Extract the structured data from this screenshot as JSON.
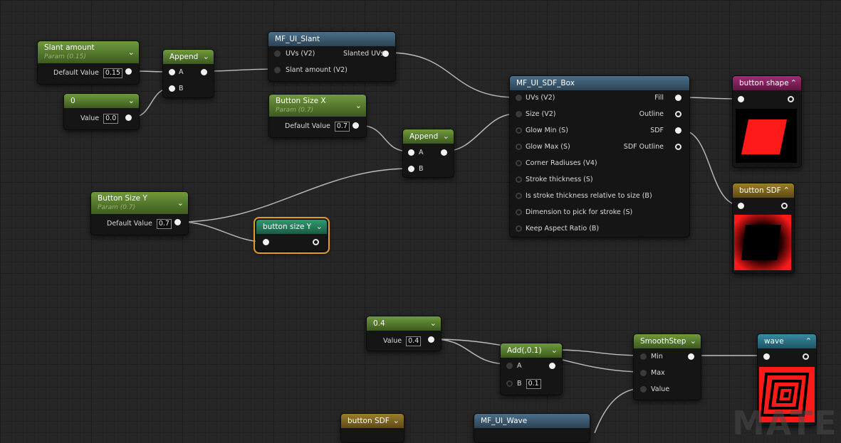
{
  "nodes": {
    "slant_amount": {
      "title": "Slant amount",
      "subtitle": "Param (0.15)",
      "label": "Default Value",
      "value": "0.15"
    },
    "const_zero": {
      "title": "0",
      "label": "Value",
      "value": "0.0"
    },
    "append_1": {
      "title": "Append",
      "pin_a": "A",
      "pin_b": "B"
    },
    "mf_ui_slant": {
      "title": "MF_UI_Slant",
      "in_uvs": "UVs (V2)",
      "in_slant": "Slant amount (V2)",
      "out": "Slanted UVs"
    },
    "button_size_x": {
      "title": "Button Size X",
      "subtitle": "Param (0.7)",
      "label": "Default Value",
      "value": "0.7"
    },
    "append_2": {
      "title": "Append",
      "pin_a": "A",
      "pin_b": "B"
    },
    "mf_ui_sdf_box": {
      "title": "MF_UI_SDF_Box",
      "inputs": [
        "UVs (V2)",
        "Size (V2)",
        "Glow Min (S)",
        "Glow Max (S)",
        "Corner Radiuses (V4)",
        "Stroke thickness (S)",
        "Is stroke thickness relative to size (B)",
        "Dimension to pick for stroke (S)",
        "Keep Aspect Ratio (B)"
      ],
      "outputs": [
        "Fill",
        "Outline",
        "SDF",
        "SDF Outline"
      ]
    },
    "button_shape": {
      "title": "button shape"
    },
    "button_sdf_preview": {
      "title": "button SDF"
    },
    "button_size_y": {
      "title": "Button Size Y",
      "subtitle": "Param (0.7)",
      "label": "Default Value",
      "value": "0.7"
    },
    "button_size_y_reroute": {
      "title": "button size Y"
    },
    "const_04": {
      "title": "0.4",
      "label": "Value",
      "value": "0.4"
    },
    "add_01": {
      "title": "Add(,0.1)",
      "pin_a": "A",
      "pin_b": "B",
      "b_value": "0.1"
    },
    "smoothstep": {
      "title": "SmoothStep",
      "in_min": "Min",
      "in_max": "Max",
      "in_value": "Value"
    },
    "wave": {
      "title": "wave"
    },
    "button_sdf_bottom": {
      "title": "button SDF"
    },
    "mf_ui_wave": {
      "title": "MF_UI_Wave"
    }
  },
  "watermark": "MATERI",
  "colors": {
    "selection": "#e09a2a",
    "preview_red": "#ff1a1a"
  }
}
